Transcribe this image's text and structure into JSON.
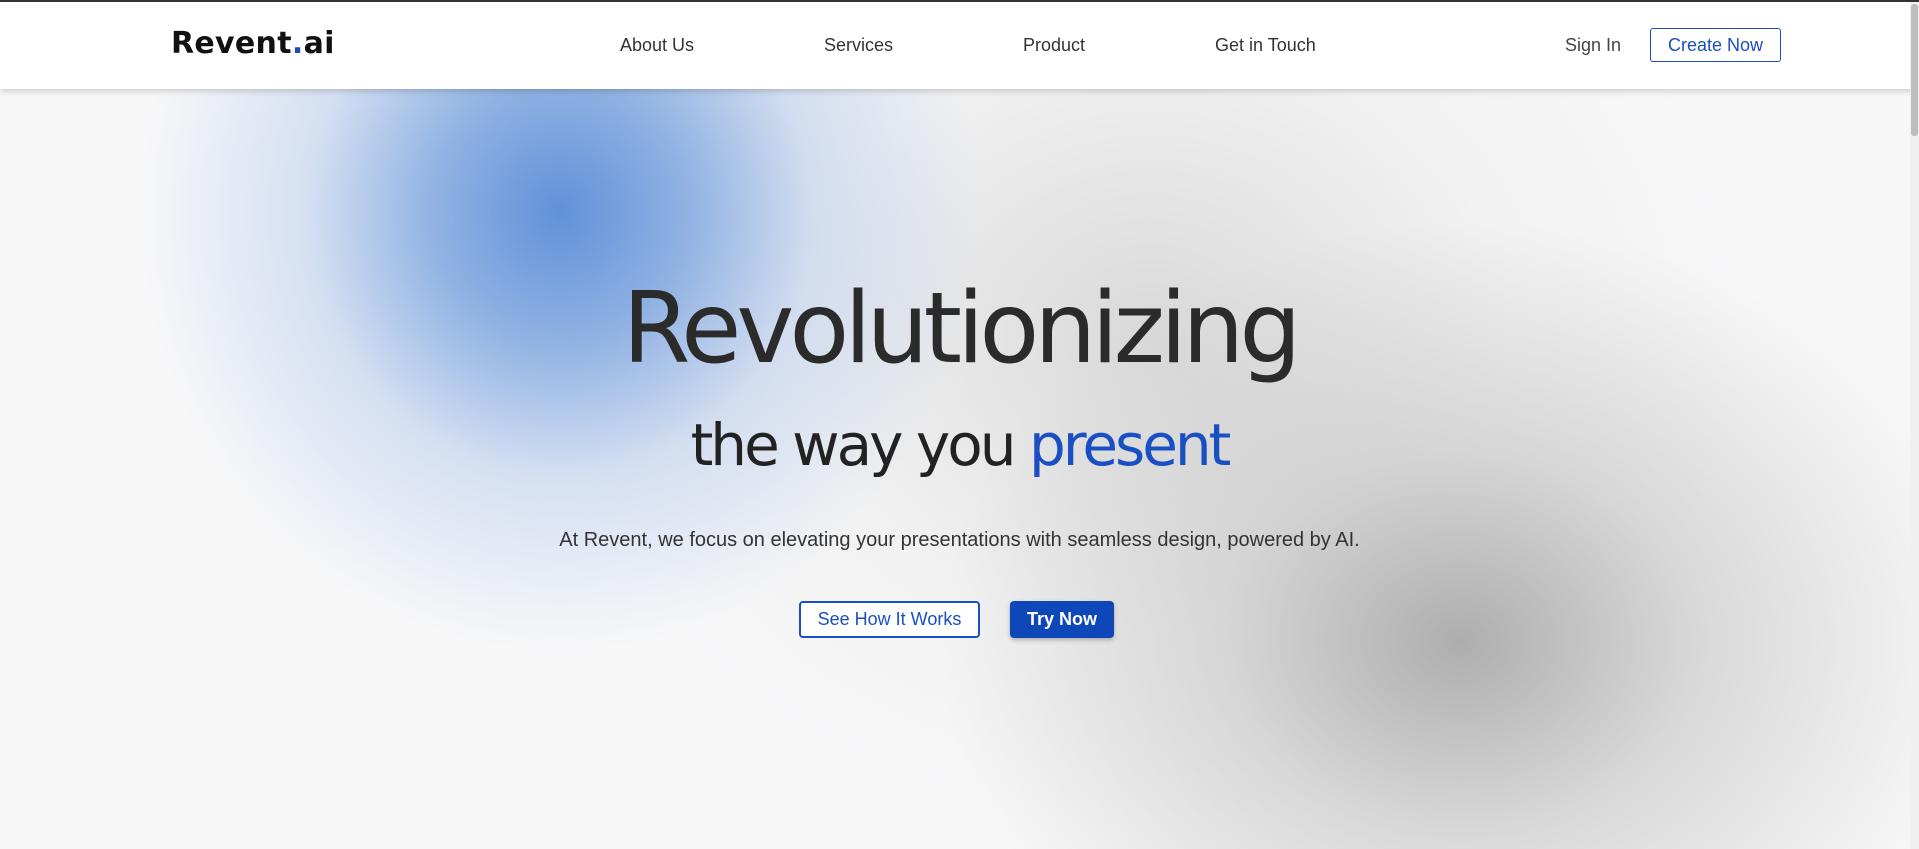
{
  "header": {
    "logo_text": "Revent",
    "logo_dot": ".",
    "logo_suffix": "ai",
    "nav": [
      {
        "label": "About Us"
      },
      {
        "label": "Services"
      },
      {
        "label": "Product"
      },
      {
        "label": "Get in Touch"
      }
    ],
    "sign_in_label": "Sign In",
    "create_label": "Create Now"
  },
  "hero": {
    "title": "Revolutionizing",
    "subtitle_prefix": "the way you ",
    "subtitle_accent": "present",
    "description": "At Revent, we focus on elevating your presentations with seamless design, powered by AI.",
    "secondary_button": "See How It Works",
    "primary_button": "Try Now"
  },
  "colors": {
    "accent": "#1a4fc4",
    "primary_button_bg": "#0d47b8",
    "text_dark": "#2b2b2b"
  }
}
